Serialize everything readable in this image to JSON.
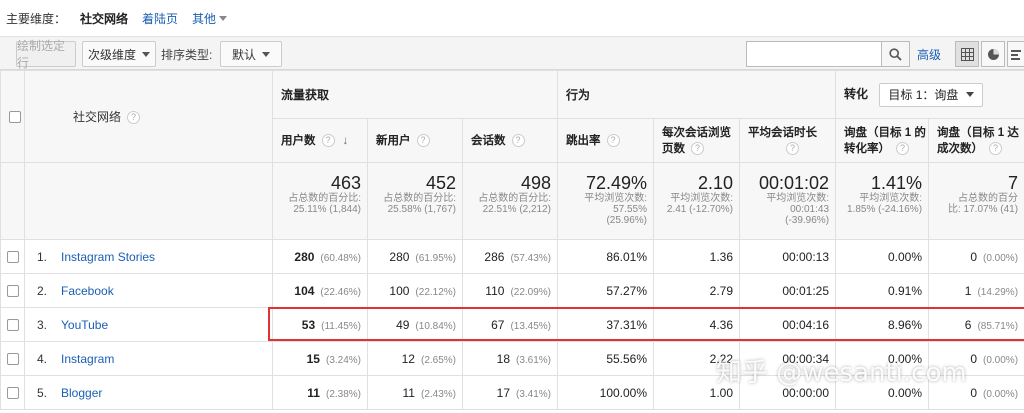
{
  "dimension_bar": {
    "label": "主要维度：",
    "current": "社交网络",
    "link": "着陆页",
    "more": "其他"
  },
  "toolbar": {
    "plot_rows": "绘制选定行",
    "secondary_dimension": "次级维度",
    "sort_type_label": "排序类型:",
    "sort_default": "默认",
    "search_placeholder": "",
    "advanced": "高级"
  },
  "table": {
    "dimension_header": "社交网络",
    "groups": {
      "acquisition": "流量获取",
      "behavior": "行为",
      "conversion": "转化",
      "goal_select": "目标 1：询盘"
    },
    "columns": {
      "users": "用户数",
      "new_users": "新用户",
      "sessions": "会话数",
      "bounce_rate": "跳出率",
      "pages_per_session_1": "每次会话浏览",
      "pages_per_session_2": "页数",
      "avg_session_duration": "平均会话时长",
      "conv_rate_1": "询盘（目标 1 的",
      "conv_rate_2": "转化率）",
      "completions_1": "询盘（目标 1 达",
      "completions_2": "成次数）"
    },
    "totals": {
      "users": {
        "value": "463",
        "sub1": "占总数的百分比:",
        "sub2": "25.11% (1,844)"
      },
      "new_users": {
        "value": "452",
        "sub1": "占总数的百分比:",
        "sub2": "25.58% (1,767)"
      },
      "sessions": {
        "value": "498",
        "sub1": "占总数的百分比:",
        "sub2": "22.51% (2,212)"
      },
      "bounce_rate": {
        "value": "72.49%",
        "sub1": "平均浏览次数:",
        "sub2": "57.55%",
        "sub3": "(25.96%)"
      },
      "pages": {
        "value": "2.10",
        "sub1": "平均浏览次数:",
        "sub2": "2.41 (-12.70%)"
      },
      "duration": {
        "value": "00:01:02",
        "sub1": "平均浏览次数:",
        "sub2": "00:01:43",
        "sub3": "(-39.96%)"
      },
      "conv_rate": {
        "value": "1.41%",
        "sub1": "平均浏览次数:",
        "sub2": "1.85% (-24.16%)"
      },
      "completions": {
        "value": "7",
        "sub1": "占总数的百分",
        "sub2": "比: 17.07% (41)"
      }
    },
    "rows": [
      {
        "n": "1.",
        "name": "Instagram Stories",
        "users": "280",
        "users_pct": "(60.48%)",
        "new_users": "280",
        "new_users_pct": "(61.95%)",
        "sessions": "286",
        "sessions_pct": "(57.43%)",
        "bounce": "86.01%",
        "pages": "1.36",
        "duration": "00:00:13",
        "conv": "0.00%",
        "comp": "0",
        "comp_pct": "(0.00%)"
      },
      {
        "n": "2.",
        "name": "Facebook",
        "users": "104",
        "users_pct": "(22.46%)",
        "new_users": "100",
        "new_users_pct": "(22.12%)",
        "sessions": "110",
        "sessions_pct": "(22.09%)",
        "bounce": "57.27%",
        "pages": "2.79",
        "duration": "00:01:25",
        "conv": "0.91%",
        "comp": "1",
        "comp_pct": "(14.29%)"
      },
      {
        "n": "3.",
        "name": "YouTube",
        "users": "53",
        "users_pct": "(11.45%)",
        "new_users": "49",
        "new_users_pct": "(10.84%)",
        "sessions": "67",
        "sessions_pct": "(13.45%)",
        "bounce": "37.31%",
        "pages": "4.36",
        "duration": "00:04:16",
        "conv": "8.96%",
        "comp": "6",
        "comp_pct": "(85.71%)"
      },
      {
        "n": "4.",
        "name": "Instagram",
        "users": "15",
        "users_pct": "(3.24%)",
        "new_users": "12",
        "new_users_pct": "(2.65%)",
        "sessions": "18",
        "sessions_pct": "(3.61%)",
        "bounce": "55.56%",
        "pages": "2.22",
        "duration": "00:00:34",
        "conv": "0.00%",
        "comp": "0",
        "comp_pct": "(0.00%)"
      },
      {
        "n": "5.",
        "name": "Blogger",
        "users": "11",
        "users_pct": "(2.38%)",
        "new_users": "11",
        "new_users_pct": "(2.43%)",
        "sessions": "17",
        "sessions_pct": "(3.41%)",
        "bounce": "100.00%",
        "pages": "1.00",
        "duration": "00:00:00",
        "conv": "0.00%",
        "comp": "0",
        "comp_pct": "(0.00%)"
      }
    ]
  },
  "watermark": "知乎 @wesanti.com",
  "colors": {
    "link": "#1a5fb4",
    "highlight": "#e03434",
    "header_bg": "#f7f7f7"
  }
}
